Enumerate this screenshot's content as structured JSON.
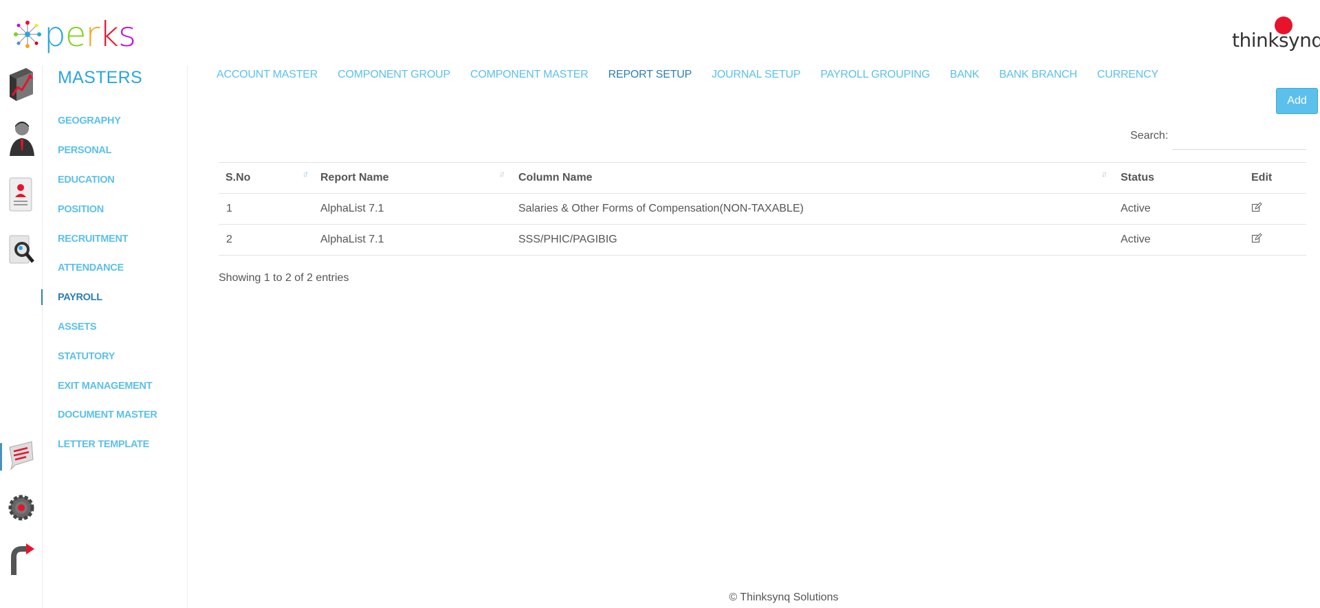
{
  "header": {
    "logo_left_text": "perks",
    "logo_right_text": "thinksynq"
  },
  "rail": {
    "icons": [
      "growth-chart-icon",
      "employee-icon",
      "resume-icon",
      "search-profile-icon",
      "chat-icon",
      "settings-gear-icon",
      "exit-icon"
    ]
  },
  "masters": {
    "title": "MASTERS",
    "items": [
      {
        "label": "GEOGRAPHY"
      },
      {
        "label": "PERSONAL"
      },
      {
        "label": "EDUCATION"
      },
      {
        "label": "POSITION"
      },
      {
        "label": "RECRUITMENT"
      },
      {
        "label": "ATTENDANCE"
      },
      {
        "label": "PAYROLL"
      },
      {
        "label": "ASSETS"
      },
      {
        "label": "STATUTORY"
      },
      {
        "label": "EXIT MANAGEMENT"
      },
      {
        "label": "DOCUMENT MASTER"
      },
      {
        "label": "LETTER TEMPLATE"
      }
    ],
    "active_item": "PAYROLL"
  },
  "tabs": [
    {
      "label": "ACCOUNT MASTER"
    },
    {
      "label": "COMPONENT GROUP"
    },
    {
      "label": "COMPONENT MASTER"
    },
    {
      "label": "REPORT SETUP"
    },
    {
      "label": "JOURNAL SETUP"
    },
    {
      "label": "PAYROLL GROUPING"
    },
    {
      "label": "BANK"
    },
    {
      "label": "BANK BRANCH"
    },
    {
      "label": "CURRENCY"
    }
  ],
  "active_tab": "REPORT SETUP",
  "toolbar": {
    "add_label": "Add"
  },
  "search": {
    "label": "Search:",
    "value": "",
    "placeholder": ""
  },
  "table": {
    "columns": [
      "S.No",
      "Report Name",
      "Column Name",
      "Status",
      "Edit"
    ],
    "rows": [
      {
        "sno": "1",
        "report_name": "AlphaList 7.1",
        "column_name": "Salaries & Other Forms of Compensation(NON-TAXABLE)",
        "status": "Active"
      },
      {
        "sno": "2",
        "report_name": "AlphaList 7.1",
        "column_name": "SSS/PHIC/PAGIBIG",
        "status": "Active"
      }
    ]
  },
  "entries_info": "Showing 1 to 2 of 2 entries",
  "footer": {
    "text": "© Thinksynq Solutions"
  },
  "colors": {
    "accent": "#5bc0eb",
    "active": "#2b7eb6",
    "brand_red": "#e8132b"
  }
}
